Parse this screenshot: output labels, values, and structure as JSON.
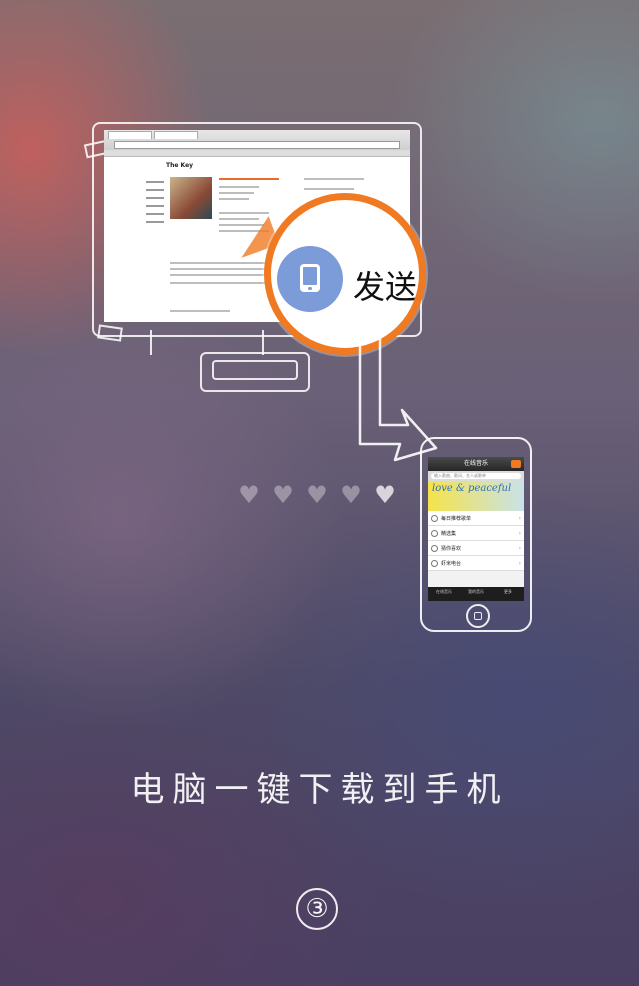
{
  "monitor": {
    "page_title": "The Key"
  },
  "magnifier": {
    "label": "发送到",
    "icon": "tablet-icon",
    "accent": "#f07a22",
    "icon_bg": "#7c9bd9"
  },
  "phone": {
    "header_title": "在线音乐",
    "search_placeholder": "输入歌曲、歌词、艺人或歌单",
    "banner_text": "love & peaceful",
    "rows": [
      {
        "label": "每日推荐歌单"
      },
      {
        "label": "精选集"
      },
      {
        "label": "猜你喜欢"
      },
      {
        "label": "虾米电台"
      }
    ],
    "tabs": [
      "在线音乐",
      "我的音乐",
      "更多"
    ]
  },
  "pager": {
    "total": 5,
    "active_index": 4
  },
  "caption": "电脑一键下载到手机",
  "step": "③"
}
